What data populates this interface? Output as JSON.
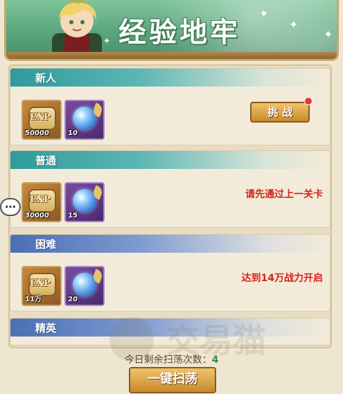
{
  "banner": {
    "title": "经验地牢"
  },
  "sections": [
    {
      "title": "新人",
      "header_color": "teal",
      "rewards": [
        {
          "type": "exp",
          "label": "EXP",
          "count": "50000"
        },
        {
          "type": "orb",
          "count": "10"
        }
      ],
      "action_label": "挑战",
      "has_notification": true
    },
    {
      "title": "普通",
      "header_color": "teal",
      "rewards": [
        {
          "type": "exp",
          "label": "EXP",
          "count": "30000"
        },
        {
          "type": "orb",
          "count": "15"
        }
      ],
      "locked_message": "请先通过上一关卡"
    },
    {
      "title": "困难",
      "header_color": "blue",
      "rewards": [
        {
          "type": "exp",
          "label": "EXP",
          "count": "11万"
        },
        {
          "type": "orb",
          "count": "20"
        }
      ],
      "locked_message": "达到14万战力开启"
    },
    {
      "title": "精英",
      "header_color": "blue"
    }
  ],
  "footer": {
    "sweep_label": "今日剩余扫荡次数：",
    "sweep_count": "4",
    "sweep_button": "一键扫荡"
  },
  "chat": {
    "icon_text": "…"
  },
  "watermark": {
    "text": "交易猫"
  },
  "colors": {
    "accent_gold": "#c98a2d",
    "locked_red": "#d6231c",
    "count_green": "#2f8f3a"
  }
}
